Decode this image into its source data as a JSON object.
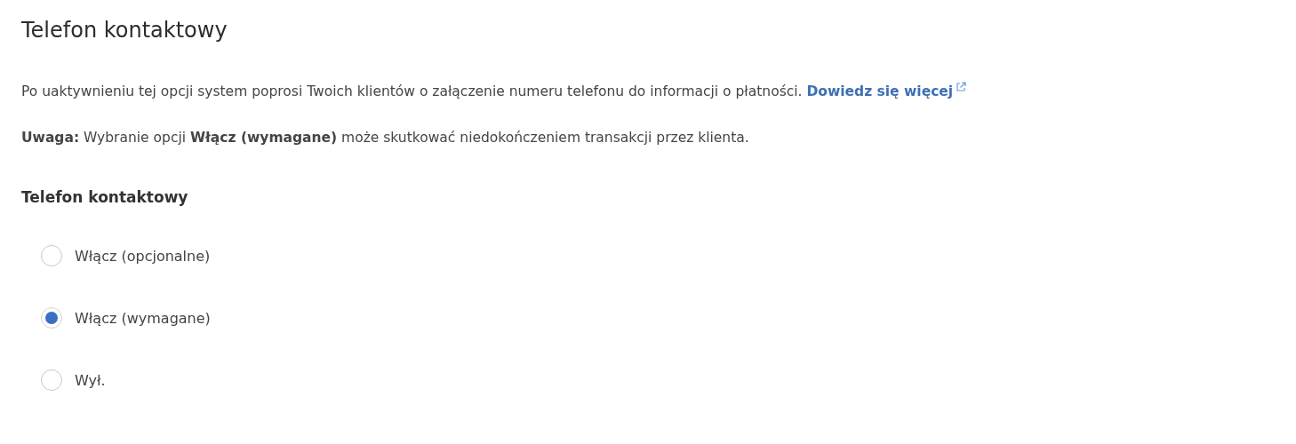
{
  "title": "Telefon kontaktowy",
  "intro": {
    "text": "Po uaktywnieniu tej opcji system poprosi Twoich klientów o załączenie numeru telefonu do informacji o płatności.",
    "link": "Dowiedz się więcej"
  },
  "notice": "**Uwaga:** Wybranie opcji **Włącz (wymagane)** może skutkować niedokończeniem transakcji przez klienta.",
  "field_label": "Telefon kontaktowy",
  "options": [
    {
      "label": "Włącz (opcjonalne)",
      "selected": false
    },
    {
      "label": "Włącz (wymagane)",
      "selected": true
    },
    {
      "label": "Wył.",
      "selected": false
    }
  ]
}
